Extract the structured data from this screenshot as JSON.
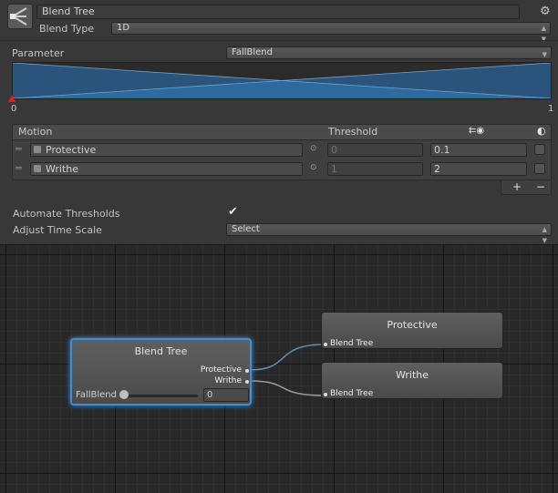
{
  "header": {
    "name_value": "Blend Tree",
    "blend_type_label": "Blend Type",
    "blend_type_value": "1D"
  },
  "parameter": {
    "label": "Parameter",
    "value": "FallBlend",
    "range_min": "0",
    "range_max": "1",
    "marker_value": 0
  },
  "motion_table": {
    "col_motion": "Motion",
    "col_threshold": "Threshold",
    "rows": [
      {
        "clip": "Protective",
        "param_value": "0",
        "threshold": "0.1"
      },
      {
        "clip": "Writhe",
        "param_value": "1",
        "threshold": "2"
      }
    ],
    "add_label": "+",
    "remove_label": "−"
  },
  "options": {
    "automate_label": "Automate Thresholds",
    "automate_checked": true,
    "adjust_label": "Adjust Time Scale",
    "adjust_value": "Select"
  },
  "graph": {
    "blend_node": {
      "title": "Blend Tree",
      "port1": "Protective",
      "port2": "Writhe",
      "param_label": "FallBlend",
      "param_value": "0"
    },
    "child1": {
      "title": "Protective",
      "subtitle": "Blend Tree"
    },
    "child2": {
      "title": "Writhe",
      "subtitle": "Blend Tree"
    }
  },
  "colors": {
    "accent_blue": "#3d8fd6",
    "blend_fill": "#2f6fa8",
    "marker_red": "#e02020"
  },
  "icons": [
    "blend-tree-icon",
    "gear-icon",
    "dropdown-arrow-icon",
    "drag-handle-icon",
    "clip-icon",
    "link-icon",
    "time-icon",
    "mirror-icon",
    "checkmark-icon",
    "plus-icon",
    "minus-icon"
  ]
}
